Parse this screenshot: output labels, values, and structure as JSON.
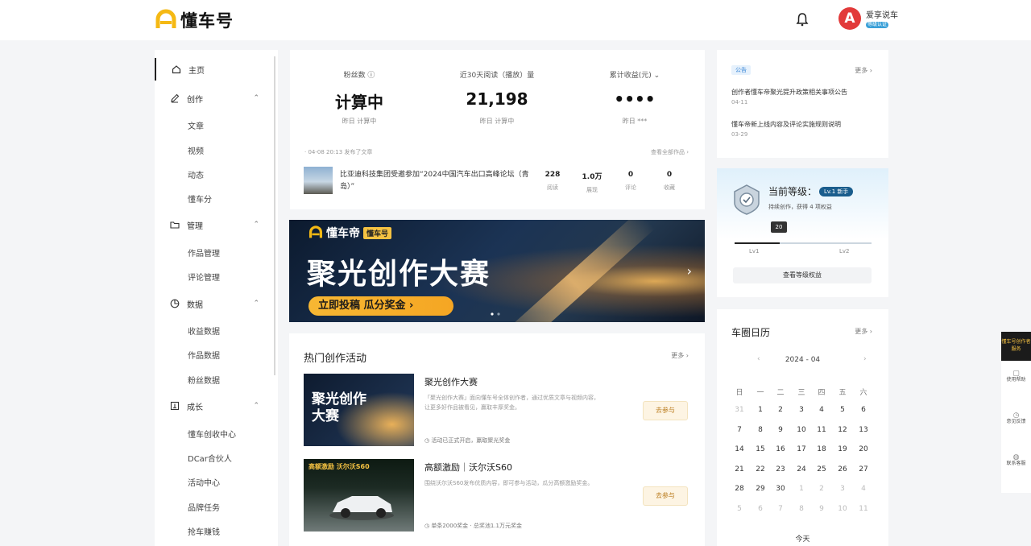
{
  "header": {
    "logo_text": "懂车号",
    "user_name": "爱享说车",
    "user_badge": "等级认证",
    "avatar_letter": "A"
  },
  "sidebar": {
    "home": "主页",
    "create": "创作",
    "create_items": [
      "文章",
      "视频",
      "动态",
      "懂车分"
    ],
    "manage": "管理",
    "manage_items": [
      "作品管理",
      "评论管理"
    ],
    "data": "数据",
    "data_items": [
      "收益数据",
      "作品数据",
      "粉丝数据"
    ],
    "growth": "成长",
    "growth_items": [
      "懂车创收中心",
      "DCar合伙人",
      "活动中心",
      "品牌任务",
      "抢车赚钱"
    ]
  },
  "stats": {
    "cols": [
      {
        "label": "粉丝数 ⓘ",
        "value": "计算中",
        "sub": "昨日 计算中"
      },
      {
        "label": "近30天阅读（播放）量",
        "value": "21,198",
        "sub": "昨日 计算中"
      },
      {
        "label": "累计收益(元) ⌄",
        "value": "••••",
        "sub": "昨日 ***"
      }
    ],
    "recent_head": "· 04-08 20:13  发布了文章",
    "recent_link": "查看全部作品 ›",
    "recent_title": "比亚迪科技集团受邀参加“2024中国汽车出口高峰论坛（青岛）”",
    "recent_metrics": [
      {
        "value": "228",
        "label": "阅读"
      },
      {
        "value": "1.0万",
        "label": "展现"
      },
      {
        "value": "0",
        "label": "评论"
      },
      {
        "value": "0",
        "label": "收藏"
      }
    ]
  },
  "banner": {
    "brand": "懂车帝",
    "tag": "懂车号",
    "title": "聚光创作大赛",
    "button": "立即投稿 瓜分奖金 ›",
    "arrow": "›"
  },
  "hot": {
    "title": "热门创作活动",
    "more": "更多 ›",
    "activities": [
      {
        "title": "聚光创作大赛",
        "desc": "「聚光创作大赛」面向懂车号全体创作者，通过优质文章与视频内容，让更多好作品被看见，赢取丰厚奖金。",
        "meta": "◷ 活动已正式开启，赢取聚光奖金",
        "button": "去参与",
        "thumb_text": "聚光创作大赛"
      },
      {
        "title": "高额激励｜沃尔沃S60",
        "desc": "围绕沃尔沃S60发布优质内容，即可参与活动，瓜分高额激励奖金。",
        "meta": "◷ 单条2000奖金  ·  总奖池1.1万元奖金",
        "button": "去参与",
        "thumb_text": "高额激励 沃尔沃S60"
      }
    ]
  },
  "notice": {
    "tag": "公告",
    "more": "更多 ›",
    "items": [
      {
        "text": "创作者懂车帝聚光提升政策相关事项公告",
        "date": "04-11"
      },
      {
        "text": "懂车帝新上线内容及评论实施规则说明",
        "date": "03-29"
      }
    ]
  },
  "level": {
    "label": "当前等级：",
    "pill": "Lv.1 新手",
    "sub": "持续创作，获得 4 项权益",
    "progress_marker": "20",
    "progress": 0.33,
    "lv_left": "Lv1",
    "lv_right": "Lv2",
    "button": "查看等级权益"
  },
  "calendar": {
    "title": "车圈日历",
    "more": "更多 ›",
    "month": "2024 - 04",
    "weekdays": [
      "日",
      "一",
      "二",
      "三",
      "四",
      "五",
      "六"
    ],
    "days": [
      "31",
      "1",
      "2",
      "3",
      "4",
      "5",
      "6",
      "7",
      "8",
      "9",
      "10",
      "11",
      "12",
      "13",
      "14",
      "15",
      "16",
      "17",
      "18",
      "19",
      "20",
      "21",
      "22",
      "23",
      "24",
      "25",
      "26",
      "27",
      "28",
      "29",
      "30",
      "1",
      "2",
      "3",
      "4",
      "5",
      "6",
      "7",
      "8",
      "9",
      "10",
      "11"
    ],
    "today": "今天"
  },
  "floatbar": {
    "top": "懂车号创作者服务",
    "items": [
      "使用帮助",
      "意见反馈",
      "联系客服"
    ]
  },
  "colors": {
    "accent_yellow": "#f5c242",
    "level_pill": "#1a5d8d",
    "avatar": "#e23a3a"
  }
}
